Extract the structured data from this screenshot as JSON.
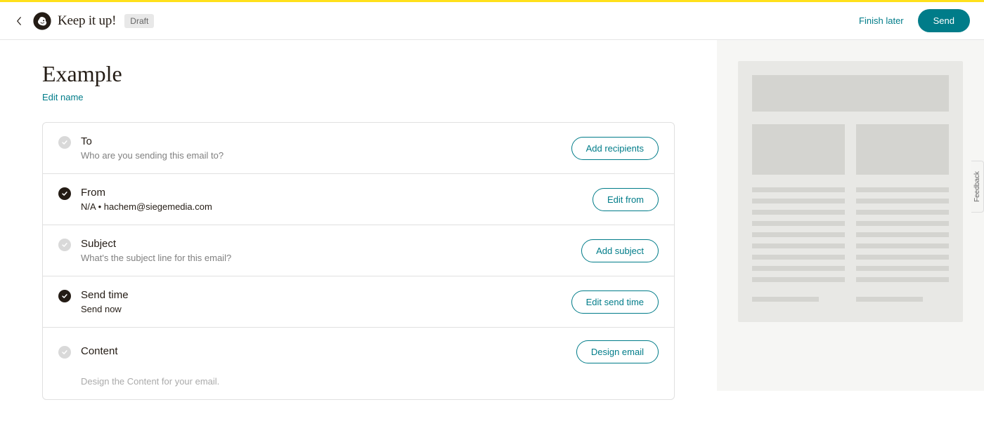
{
  "header": {
    "brand": "Keep it up!",
    "badge": "Draft",
    "finish_later": "Finish later",
    "send": "Send"
  },
  "campaign": {
    "name": "Example",
    "edit_name": "Edit name"
  },
  "rows": {
    "to": {
      "title": "To",
      "sub": "Who are you sending this email to?",
      "button": "Add recipients"
    },
    "from": {
      "title": "From",
      "sub": "N/A  •  hachem@siegemedia.com",
      "button": "Edit from"
    },
    "subject": {
      "title": "Subject",
      "sub": "What's the subject line for this email?",
      "button": "Add subject"
    },
    "sendtime": {
      "title": "Send time",
      "sub": "Send now",
      "button": "Edit send time"
    },
    "content": {
      "title": "Content",
      "desc": "Design the Content for your email.",
      "button": "Design email"
    }
  },
  "feedback": "Feedback"
}
